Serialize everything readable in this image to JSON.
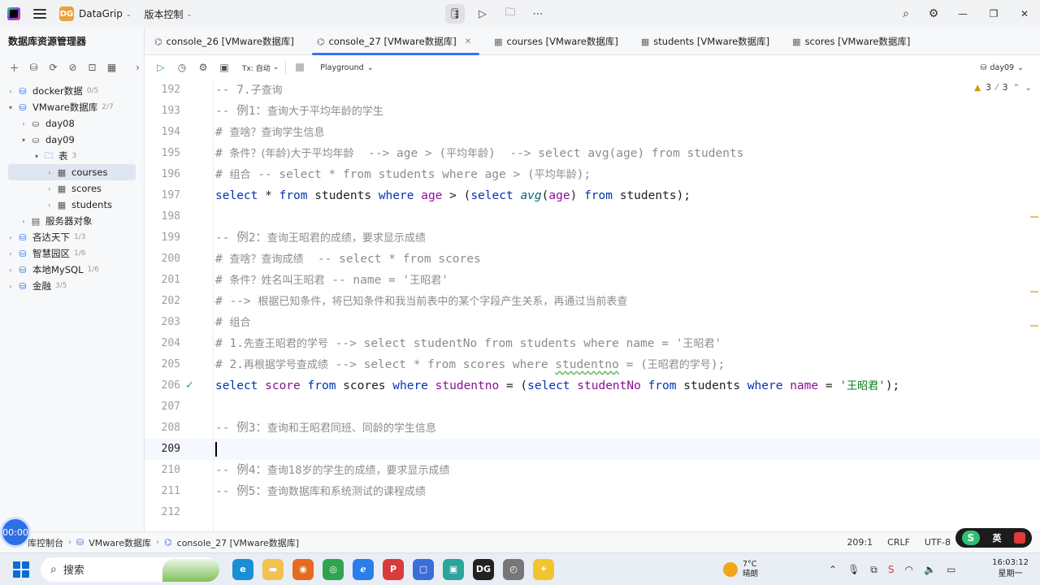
{
  "titlebar": {
    "app_name": "DataGrip",
    "project_badge": "DG",
    "vcs_label": "版本控制"
  },
  "sidebar": {
    "title": "数据库资源管理器",
    "tree": [
      {
        "label": "docker数据",
        "count": "0/5",
        "level": 0,
        "expanded": false,
        "icon": "datasource-icon"
      },
      {
        "label": "VMware数据库",
        "count": "2/7",
        "level": 0,
        "expanded": true,
        "icon": "datasource-icon"
      },
      {
        "label": "day08",
        "count": "",
        "level": 1,
        "expanded": false,
        "icon": "schema-icon"
      },
      {
        "label": "day09",
        "count": "",
        "level": 1,
        "expanded": true,
        "icon": "schema-icon"
      },
      {
        "label": "表",
        "count": "3",
        "level": 2,
        "expanded": true,
        "icon": "folder-icon"
      },
      {
        "label": "courses",
        "count": "",
        "level": 3,
        "expanded": false,
        "icon": "table-icon",
        "selected": true
      },
      {
        "label": "scores",
        "count": "",
        "level": 3,
        "expanded": false,
        "icon": "table-icon"
      },
      {
        "label": "students",
        "count": "",
        "level": 3,
        "expanded": false,
        "icon": "table-icon"
      },
      {
        "label": "服务器对象",
        "count": "",
        "level": 1,
        "expanded": false,
        "icon": "server-objects-icon"
      },
      {
        "label": "吝达天下",
        "count": "1/3",
        "level": 0,
        "expanded": false,
        "icon": "datasource-icon"
      },
      {
        "label": "智慧园区",
        "count": "1/6",
        "level": 0,
        "expanded": false,
        "icon": "datasource-icon"
      },
      {
        "label": "本地MySQL",
        "count": "1/6",
        "level": 0,
        "expanded": false,
        "icon": "datasource-icon"
      },
      {
        "label": "金融",
        "count": "3/5",
        "level": 0,
        "expanded": false,
        "icon": "datasource-icon"
      }
    ]
  },
  "tabs": [
    {
      "label": "console_26 [VMware数据库]",
      "active": false
    },
    {
      "label": "console_27 [VMware数据库]",
      "active": true
    },
    {
      "label": "courses [VMware数据库]",
      "active": false
    },
    {
      "label": "students [VMware数据库]",
      "active": false
    },
    {
      "label": "scores [VMware数据库]",
      "active": false
    }
  ],
  "editor_toolbar": {
    "tx_label": "Tx: 自动",
    "playground_label": "Playground",
    "schema_label": "day09"
  },
  "inspections": {
    "warnings": "3",
    "weak_warnings": "3"
  },
  "editor": {
    "current_line": "209",
    "lines": [
      {
        "n": "192",
        "tokens": [
          [
            "c",
            "-- 7."
          ],
          [
            "cc",
            "子查询"
          ]
        ]
      },
      {
        "n": "193",
        "tokens": [
          [
            "c",
            "-- 例1："
          ],
          [
            "cc",
            "查询大于平均年龄的学生"
          ]
        ]
      },
      {
        "n": "194",
        "tokens": [
          [
            "c",
            "# "
          ],
          [
            "cc",
            "查啥？查询学生信息"
          ]
        ]
      },
      {
        "n": "195",
        "tokens": [
          [
            "c",
            "# "
          ],
          [
            "cc",
            "条件？(年龄)大于平均年龄"
          ],
          [
            "c",
            "  --> age > ("
          ],
          [
            "cc",
            "平均年龄"
          ],
          [
            "c",
            ")  --> select avg(age) from students"
          ]
        ]
      },
      {
        "n": "196",
        "tokens": [
          [
            "c",
            "# "
          ],
          [
            "cc",
            "组合"
          ],
          [
            "c",
            " -- select * from students where age > ("
          ],
          [
            "cc",
            "平均年龄"
          ],
          [
            "c",
            ");"
          ]
        ]
      },
      {
        "n": "197",
        "tokens": [
          [
            "k",
            "select"
          ],
          [
            "o",
            " * "
          ],
          [
            "k",
            "from"
          ],
          [
            "i",
            " students "
          ],
          [
            "k",
            "where"
          ],
          [
            "col",
            " age"
          ],
          [
            "o",
            " > ("
          ],
          [
            "k",
            "select"
          ],
          [
            "o",
            " "
          ],
          [
            "f",
            "avg"
          ],
          [
            "o",
            "("
          ],
          [
            "col",
            "age"
          ],
          [
            "o",
            ") "
          ],
          [
            "k",
            "from"
          ],
          [
            "i",
            " students"
          ],
          [
            "o",
            ");"
          ]
        ]
      },
      {
        "n": "198",
        "tokens": []
      },
      {
        "n": "199",
        "tokens": [
          [
            "c",
            "-- 例2："
          ],
          [
            "cc",
            "查询王昭君的成绩，要求显示成绩"
          ]
        ]
      },
      {
        "n": "200",
        "tokens": [
          [
            "c",
            "# "
          ],
          [
            "cc",
            "查啥？查询成绩"
          ],
          [
            "c",
            "  -- select * from scores"
          ]
        ]
      },
      {
        "n": "201",
        "tokens": [
          [
            "c",
            "# "
          ],
          [
            "cc",
            "条件？姓名叫王昭君"
          ],
          [
            "c",
            " -- name = '"
          ],
          [
            "cc",
            "王昭君"
          ],
          [
            "c",
            "'"
          ]
        ]
      },
      {
        "n": "202",
        "tokens": [
          [
            "c",
            "# --> "
          ],
          [
            "cc",
            "根据已知条件，将已知条件和我当前表中的某个字段产生关系，再通过当前表查"
          ]
        ]
      },
      {
        "n": "203",
        "tokens": [
          [
            "c",
            "# "
          ],
          [
            "cc",
            "组合"
          ]
        ]
      },
      {
        "n": "204",
        "tokens": [
          [
            "c",
            "# 1."
          ],
          [
            "cc",
            "先查王昭君的学号"
          ],
          [
            "c",
            " --> select studentNo from students where name = '"
          ],
          [
            "cc",
            "王昭君"
          ],
          [
            "c",
            "'"
          ]
        ]
      },
      {
        "n": "205",
        "tokens": [
          [
            "c",
            "# 2."
          ],
          [
            "cc",
            "再根据学号查成绩"
          ],
          [
            "c",
            " --> select * from scores where "
          ],
          [
            "cw",
            "studentno"
          ],
          [
            "c",
            " = ("
          ],
          [
            "cc",
            "王昭君的学号"
          ],
          [
            "c",
            ");"
          ]
        ]
      },
      {
        "n": "206",
        "check": true,
        "tokens": [
          [
            "k",
            "select"
          ],
          [
            "col",
            " score "
          ],
          [
            "k",
            "from"
          ],
          [
            "i",
            " scores "
          ],
          [
            "k",
            "where"
          ],
          [
            "col",
            " studentno"
          ],
          [
            "o",
            " = ("
          ],
          [
            "k",
            "select"
          ],
          [
            "col",
            " studentNo "
          ],
          [
            "k",
            "from"
          ],
          [
            "i",
            " students "
          ],
          [
            "k",
            "where"
          ],
          [
            "col",
            " name"
          ],
          [
            "o",
            " = "
          ],
          [
            "s",
            "'"
          ],
          [
            "sc",
            "王昭君"
          ],
          [
            "s",
            "'"
          ],
          [
            "o",
            ");"
          ]
        ]
      },
      {
        "n": "207",
        "tokens": []
      },
      {
        "n": "208",
        "tokens": [
          [
            "c",
            "-- 例3："
          ],
          [
            "cc",
            "查询和王昭君同班、同龄的学生信息"
          ]
        ]
      },
      {
        "n": "209",
        "tokens": []
      },
      {
        "n": "210",
        "tokens": [
          [
            "c",
            "-- 例4："
          ],
          [
            "cc",
            "查询18岁的学生的成绩，要求显示成绩"
          ]
        ]
      },
      {
        "n": "211",
        "tokens": [
          [
            "c",
            "-- 例5："
          ],
          [
            "cc",
            "查询数据库和系统测试的课程成绩"
          ]
        ]
      },
      {
        "n": "212",
        "tokens": []
      }
    ]
  },
  "statusbar": {
    "crumb_console": "库控制台",
    "crumb_db": "VMware数据库",
    "crumb_file": "console_27 [VMware数据库]",
    "position": "209:1",
    "line_sep": "CRLF",
    "encoding": "UTF-8",
    "timer": "00:00",
    "ime_lang": "英"
  },
  "taskbar": {
    "search_placeholder": "搜索",
    "weather_temp": "7°C",
    "weather_desc": "晴朗",
    "time": "16:03:12",
    "weekday": "星期一"
  }
}
